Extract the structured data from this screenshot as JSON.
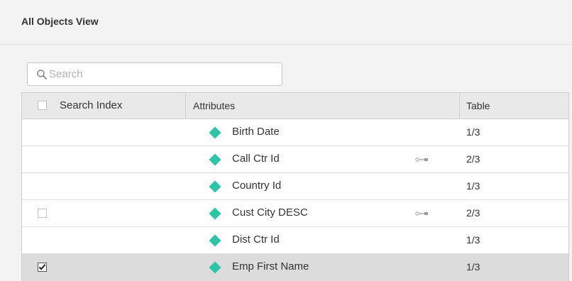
{
  "header": {
    "title": "All Objects View"
  },
  "search": {
    "placeholder": "Search",
    "value": ""
  },
  "table": {
    "columns": {
      "search_index": "Search Index",
      "attributes": "Attributes",
      "table": "Table"
    },
    "rows": [
      {
        "attribute": "Birth Date",
        "table": "1/3",
        "search_index": null,
        "has_key": false,
        "selected": false
      },
      {
        "attribute": "Call Ctr Id",
        "table": "2/3",
        "search_index": null,
        "has_key": true,
        "selected": false
      },
      {
        "attribute": "Country Id",
        "table": "1/3",
        "search_index": null,
        "has_key": false,
        "selected": false
      },
      {
        "attribute": "Cust City DESC",
        "table": "2/3",
        "search_index": false,
        "has_key": true,
        "selected": false
      },
      {
        "attribute": "Dist Ctr Id",
        "table": "1/3",
        "search_index": null,
        "has_key": false,
        "selected": false
      },
      {
        "attribute": "Emp First Name",
        "table": "1/3",
        "search_index": true,
        "has_key": false,
        "selected": true
      }
    ]
  },
  "colors": {
    "attribute_icon": "#2cc5a8",
    "header_bg": "#e9e9e9",
    "selected_row": "#dcdcdc"
  },
  "icons": {
    "search": "magnifier-icon",
    "attribute": "attribute-diamond-icon",
    "key": "key-icon"
  }
}
